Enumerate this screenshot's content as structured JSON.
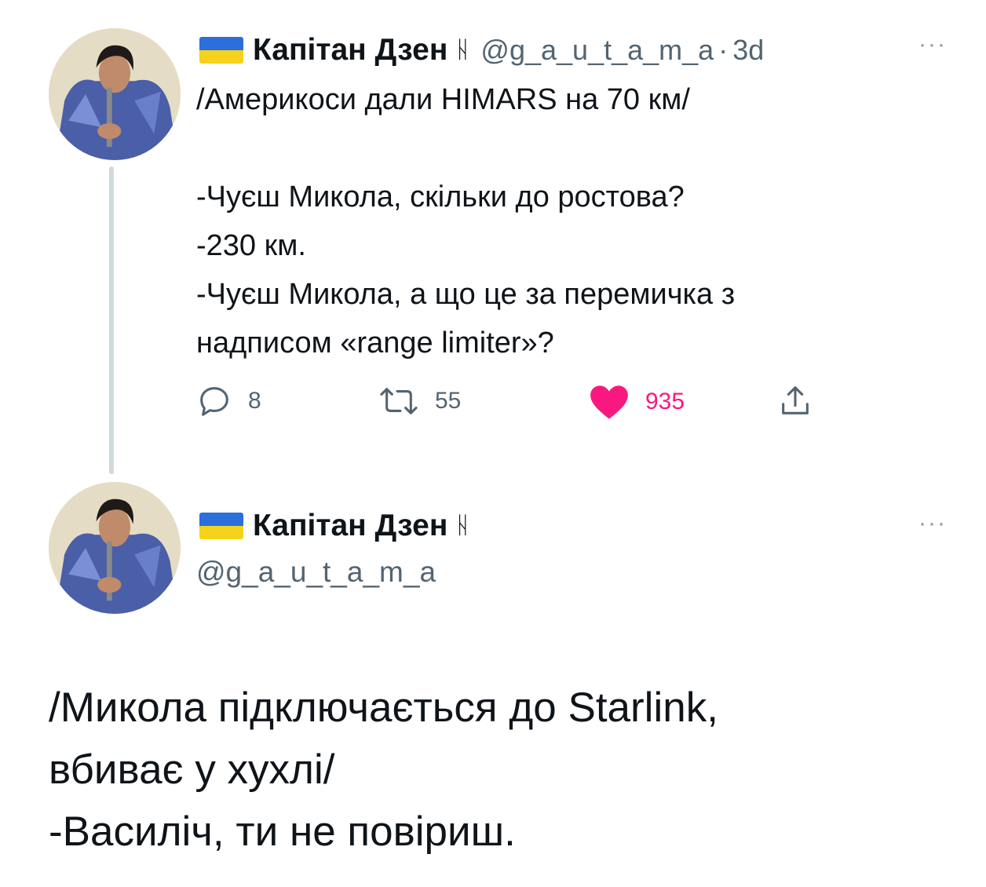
{
  "tweet1": {
    "display_name": "Капітан Дзен",
    "rune": "ᚺ",
    "handle": "@g_a_u_t_a_m_a",
    "separator": "·",
    "time": "3d",
    "more": "···",
    "lines": [
      "/Америкоси дали HIMARS на 70 км/",
      "",
      "-Чуєш Микола, скільки до ростова?",
      "-230 км.",
      "-Чуєш Микола, а що це за перемичка з",
      "надписом «range limiter»?"
    ],
    "actions": {
      "reply_count": "8",
      "retweet_count": "55",
      "like_count": "935",
      "colors": {
        "muted": "#536471",
        "like": "#f91880"
      }
    }
  },
  "tweet2": {
    "display_name": "Капітан Дзен",
    "rune": "ᚺ",
    "handle": "@g_a_u_t_a_m_a",
    "more": "···",
    "lines": [
      "/Микола підключається до Starlink,",
      "вбиває у хухлі/",
      "-Василіч, ти не повіриш."
    ]
  },
  "icons": {
    "flag": "ukraine-flag-icon",
    "reply": "reply-icon",
    "retweet": "retweet-icon",
    "like": "heart-icon",
    "share": "share-icon"
  }
}
